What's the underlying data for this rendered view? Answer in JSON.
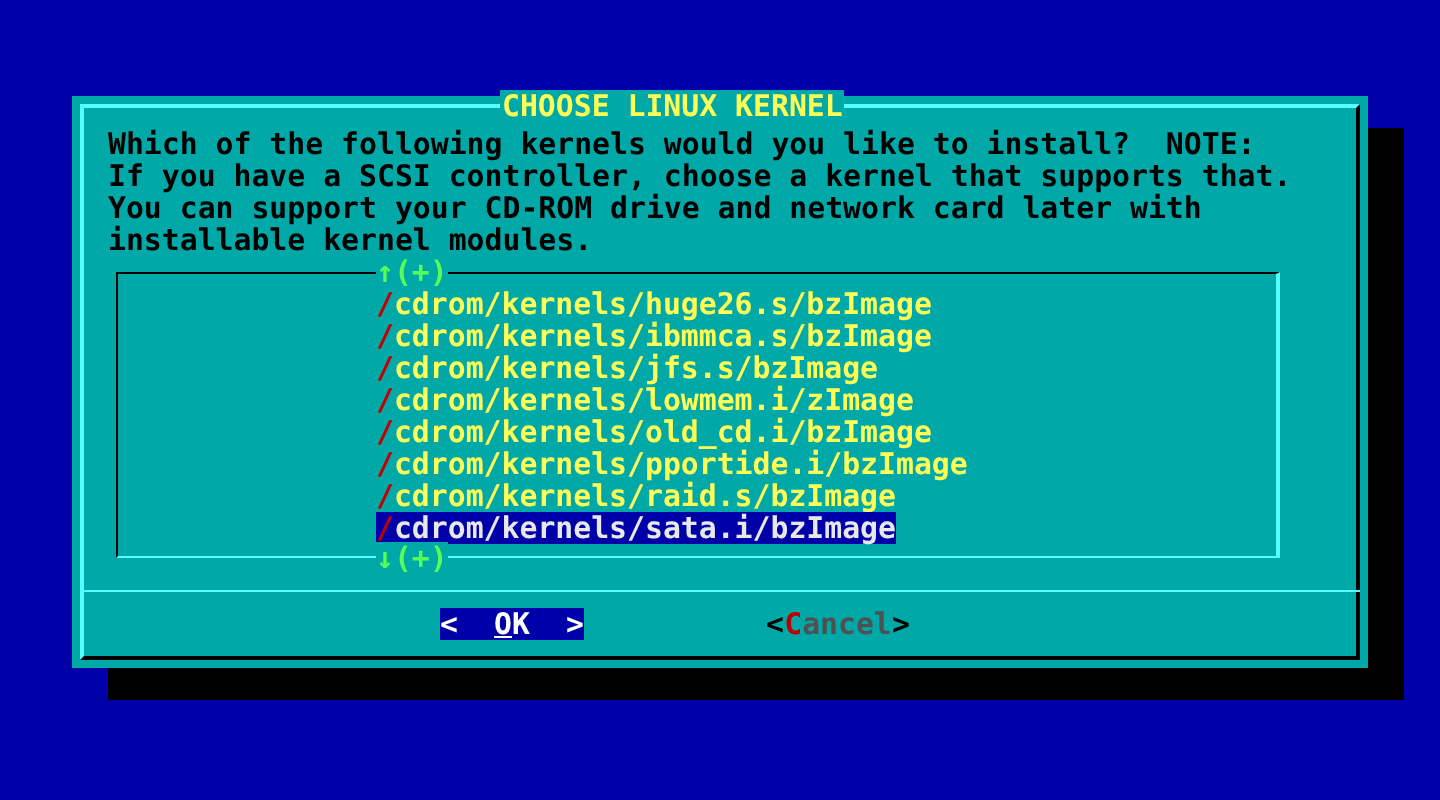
{
  "dialog": {
    "title": "CHOOSE LINUX KERNEL",
    "prompt": "Which of the following kernels would you like to install?  NOTE:\nIf you have a SCSI controller, choose a kernel that supports that.\nYou can support your CD-ROM drive and network card later with\ninstallable kernel modules.",
    "scroll_up": "↑(+)",
    "scroll_down": "↓(+)",
    "items": [
      {
        "label": "/cdrom/kernels/huge26.s/bzImage",
        "selected": false
      },
      {
        "label": "/cdrom/kernels/ibmmca.s/bzImage",
        "selected": false
      },
      {
        "label": "/cdrom/kernels/jfs.s/bzImage",
        "selected": false
      },
      {
        "label": "/cdrom/kernels/lowmem.i/zImage",
        "selected": false
      },
      {
        "label": "/cdrom/kernels/old_cd.i/bzImage",
        "selected": false
      },
      {
        "label": "/cdrom/kernels/pportide.i/bzImage",
        "selected": false
      },
      {
        "label": "/cdrom/kernels/raid.s/bzImage",
        "selected": false
      },
      {
        "label": "/cdrom/kernels/sata.i/bzImage",
        "selected": true
      }
    ],
    "buttons": [
      {
        "left": "<",
        "label": "OK",
        "right": ">",
        "selected": true
      },
      {
        "left": "<",
        "label": "Cancel",
        "right": ">",
        "selected": false
      }
    ]
  }
}
